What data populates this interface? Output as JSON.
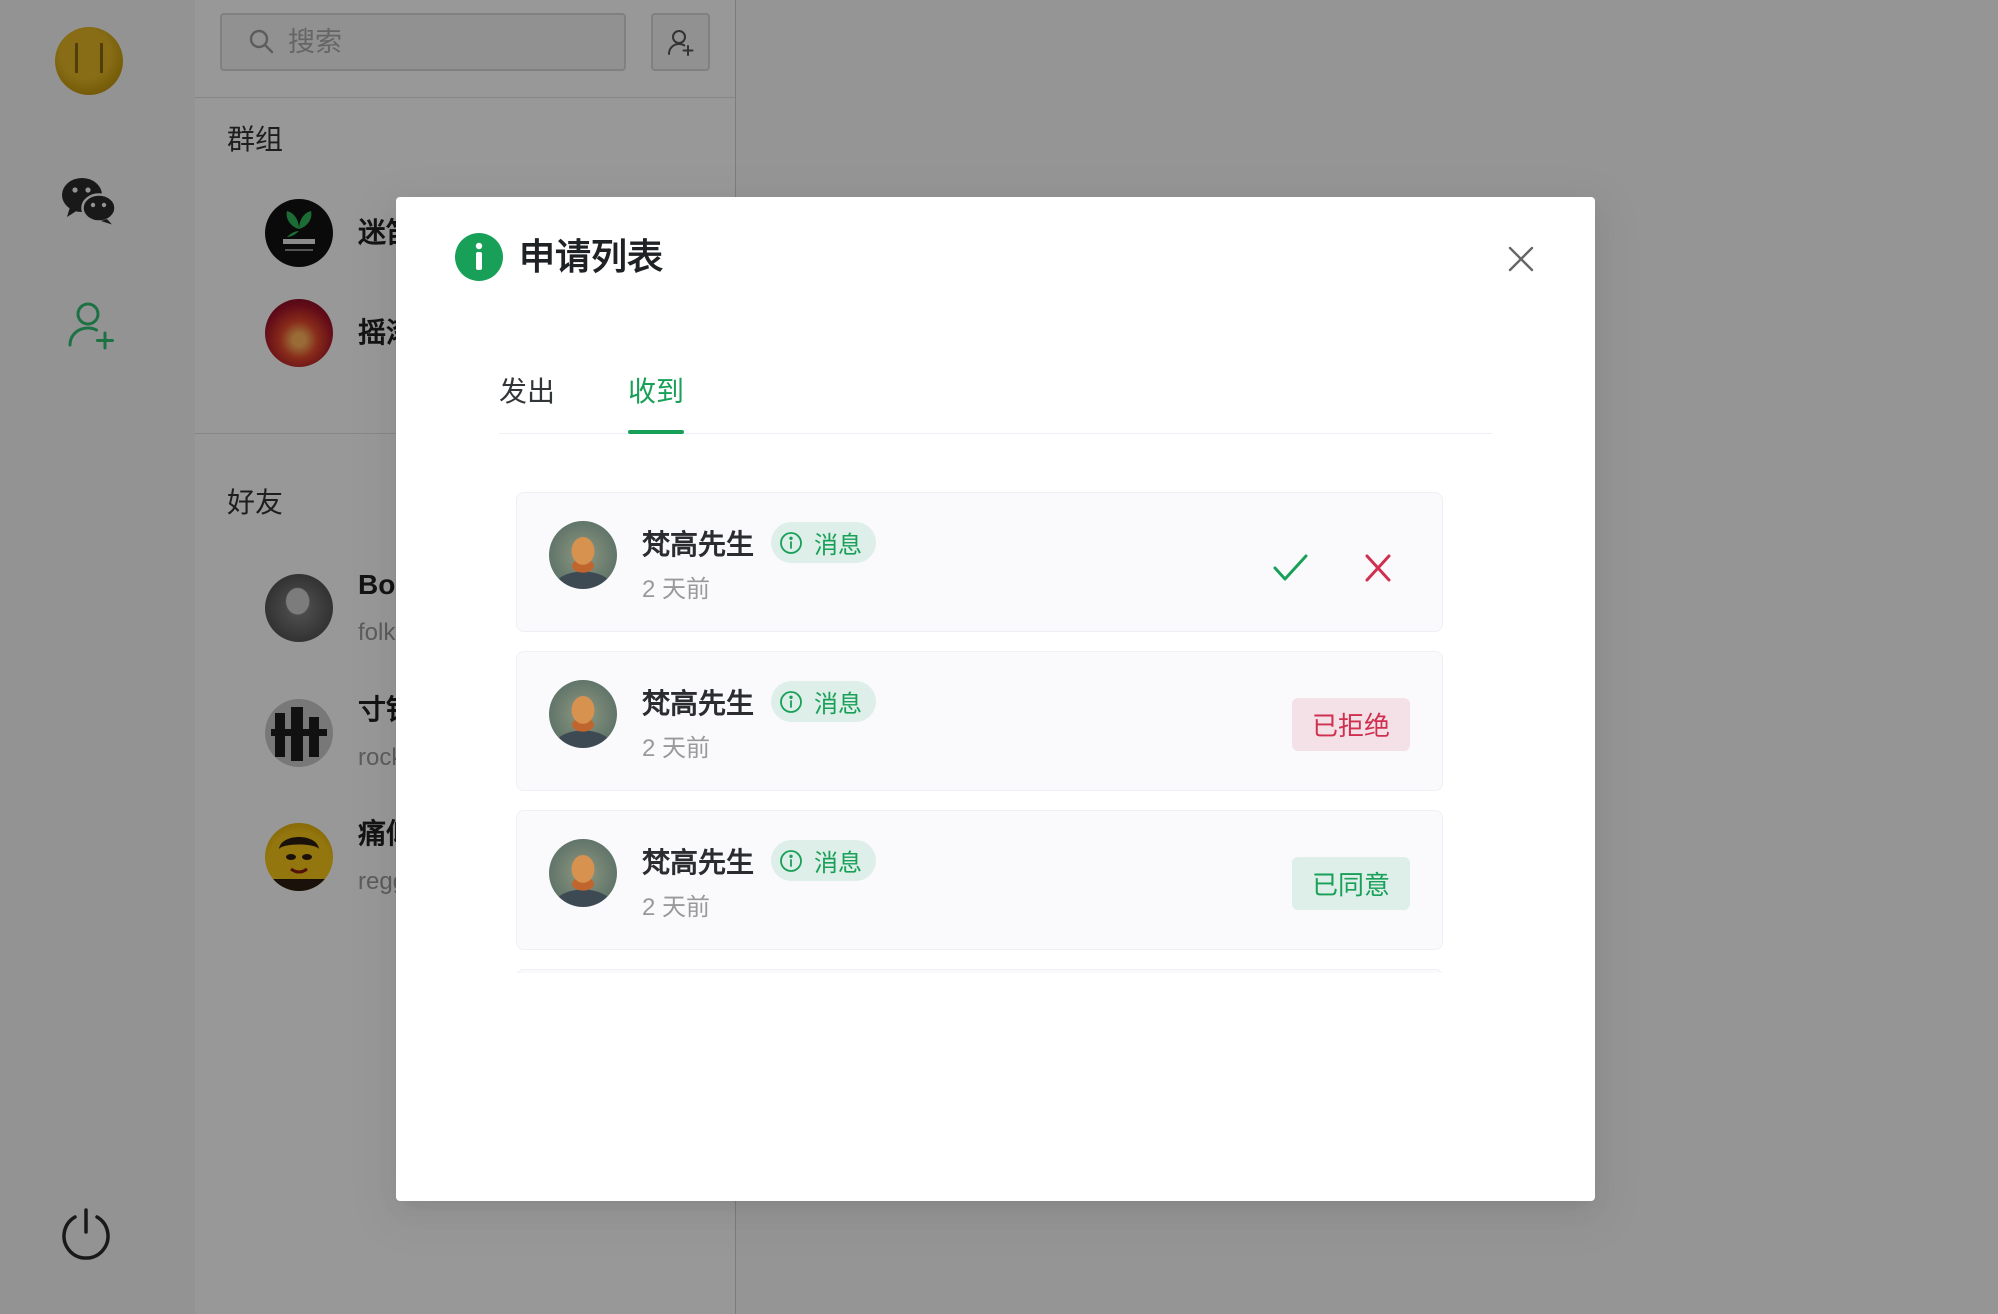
{
  "sidebar": {
    "avatar_icon": "user-avatar",
    "nav_items": [
      {
        "icon": "chat-icon"
      },
      {
        "icon": "contacts-add-icon",
        "active": true
      }
    ],
    "bottom_icon": "power-icon"
  },
  "contacts_panel": {
    "search": {
      "placeholder": "搜索",
      "icon": "search-icon"
    },
    "add_button_icon": "add-friend-icon",
    "groups_title": "群组",
    "groups": [
      {
        "name": "迷笛"
      },
      {
        "name": "摇滚"
      }
    ],
    "friends_title": "好友",
    "friends": [
      {
        "name": "Bob",
        "subtitle": "folk"
      },
      {
        "name": "寸铁",
        "subtitle": "rock"
      },
      {
        "name": "痛仰",
        "subtitle": "reggae"
      }
    ]
  },
  "modal": {
    "icon": "info-icon",
    "title": "申请列表",
    "close_icon": "close-icon",
    "tabs": [
      {
        "label": "发出",
        "active": false
      },
      {
        "label": "收到",
        "active": true
      }
    ],
    "requests": [
      {
        "name": "梵高先生",
        "badge": "消息",
        "badge_icon": "info-circle-icon",
        "time": "2 天前",
        "actions_visible": true,
        "accept_icon": "check-icon",
        "reject_icon": "x-icon"
      },
      {
        "name": "梵高先生",
        "badge": "消息",
        "badge_icon": "info-circle-icon",
        "time": "2 天前",
        "status_label": "已拒绝",
        "status_color": "#d03050"
      },
      {
        "name": "梵高先生",
        "badge": "消息",
        "badge_icon": "info-circle-icon",
        "time": "2 天前",
        "status_label": "已同意",
        "status_color": "#18a058"
      }
    ]
  },
  "colors": {
    "accent": "#18a058",
    "danger": "#d03050",
    "text": "#333639",
    "muted": "#999999",
    "nav_active": "#2fbf71",
    "overlay": "rgba(0,0,0,0.4)"
  }
}
